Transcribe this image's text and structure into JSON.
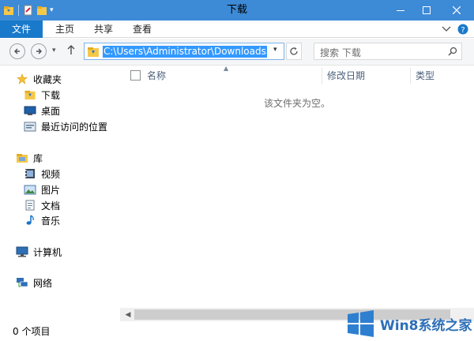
{
  "window": {
    "title": "下载"
  },
  "ribbon": {
    "tabs": [
      "文件",
      "主页",
      "共享",
      "查看"
    ]
  },
  "address": {
    "path": "C:\\Users\\Administrator\\Downloads",
    "search_placeholder": "搜索 下载"
  },
  "nav": {
    "favorites_label": "收藏夹",
    "favorites": [
      "下载",
      "桌面",
      "最近访问的位置"
    ],
    "library_label": "库",
    "library": [
      "视频",
      "图片",
      "文档",
      "音乐"
    ],
    "computer_label": "计算机",
    "network_label": "网络"
  },
  "columns": [
    "名称",
    "修改日期",
    "类型"
  ],
  "content": {
    "empty_message": "该文件夹为空。"
  },
  "status": {
    "item_count": "0 个项目"
  },
  "watermark": {
    "text": "Win8系统之家"
  },
  "colors": {
    "titlebar": "#3d8ad6",
    "file_tab": "#1979ca",
    "selection": "#3399ff",
    "accent_blue": "#2c6fb7"
  },
  "icons": [
    "folder-down-icon",
    "back-icon",
    "forward-icon",
    "up-icon",
    "refresh-icon",
    "search-icon",
    "star-icon",
    "desktop-icon",
    "recent-icon",
    "library-icon",
    "video-icon",
    "picture-icon",
    "document-icon",
    "music-icon",
    "computer-icon",
    "network-icon",
    "windows-logo-icon"
  ]
}
